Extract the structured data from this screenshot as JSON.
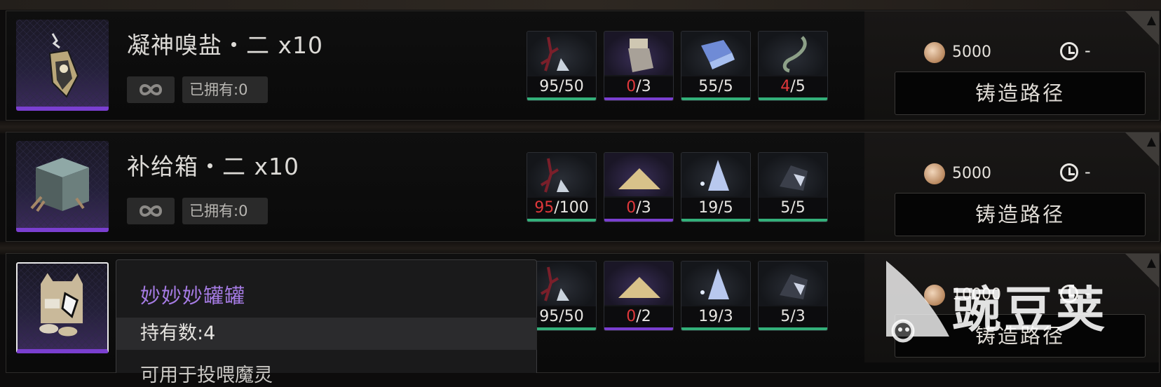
{
  "rows": [
    {
      "title": "凝神嗅盐・二 x10",
      "owned": "已拥有:0",
      "materials": [
        {
          "have": "95",
          "need": "/50",
          "short": false,
          "bar": "#33b07a"
        },
        {
          "have": "0",
          "need": "/3",
          "short": true,
          "bar": "#7a3fd0"
        },
        {
          "have": "55",
          "need": "/5",
          "short": false,
          "bar": "#33b07a"
        },
        {
          "have": "4",
          "need": "/5",
          "short": true,
          "bar": "#33b07a"
        }
      ],
      "cost": "5000",
      "time": "-",
      "forge_label": "铸造路径"
    },
    {
      "title": "补给箱・二 x10",
      "owned": "已拥有:0",
      "materials": [
        {
          "have": "95",
          "need": "/100",
          "short": true,
          "bar": "#33b07a"
        },
        {
          "have": "0",
          "need": "/3",
          "short": true,
          "bar": "#7a3fd0"
        },
        {
          "have": "19",
          "need": "/5",
          "short": false,
          "bar": "#33b07a"
        },
        {
          "have": "5",
          "need": "/5",
          "short": false,
          "bar": "#33b07a"
        }
      ],
      "cost": "5000",
      "time": "-",
      "forge_label": "铸造路径"
    },
    {
      "materials": [
        {
          "have": "95",
          "need": "/50",
          "short": false,
          "bar": "#33b07a"
        },
        {
          "have": "0",
          "need": "/2",
          "short": true,
          "bar": "#7a3fd0"
        },
        {
          "have": "19",
          "need": "/3",
          "short": false,
          "bar": "#33b07a"
        },
        {
          "have": "5",
          "need": "/3",
          "short": false,
          "bar": "#33b07a"
        }
      ],
      "cost": "10000",
      "time": "-",
      "forge_label": "铸造路径"
    }
  ],
  "tooltip": {
    "name": "妙妙妙罐罐",
    "count": "持有数:4",
    "line": "可用于投喂魔灵"
  },
  "watermark": {
    "text": "豌豆荚"
  },
  "colors": {
    "accent_purple": "#7a3fd0",
    "shortage_red": "#e0383b",
    "ok_green": "#33b07a",
    "tooltip_name": "#a57be3"
  }
}
